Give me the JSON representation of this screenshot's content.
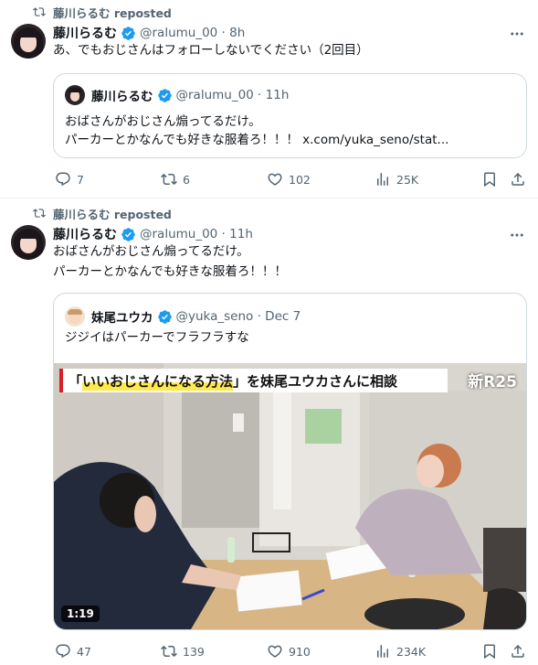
{
  "tweet1": {
    "repost_label": "藤川らるむ reposted",
    "author_name": "藤川らるむ",
    "meta": "@ralumu_00 · 8h",
    "text": "あ、でもおじさんはフォローしないでください（2回目）",
    "quote": {
      "author_name": "藤川らるむ",
      "meta": "@ralumu_00 · 11h",
      "line1": "おばさんがおじさん煽ってるだけ。",
      "line2_text": "パーカーとかなんでも好きな服着ろ！！！ ",
      "line2_link": "x.com/yuka_seno/stat..."
    },
    "actions": {
      "replies": "7",
      "reposts": "6",
      "likes": "102",
      "views": "25K"
    }
  },
  "tweet2": {
    "repost_label": "藤川らるむ reposted",
    "author_name": "藤川らるむ",
    "meta": "@ralumu_00 · 11h",
    "line1": "おばさんがおじさん煽ってるだけ。",
    "line2": "パーカーとかなんでも好きな服着ろ！！！",
    "quote": {
      "author_name": "妹尾ユウカ",
      "meta": "@yuka_seno · Dec 7",
      "text": "ジジイはパーカーでフラフラすな",
      "video": {
        "title_a": "「",
        "title_b": "いいおじさんになる方法",
        "title_c": "」を妹尾ユウカさんに相談",
        "logo": "新R25",
        "duration": "1:19"
      }
    },
    "actions": {
      "replies": "47",
      "reposts": "139",
      "likes": "910",
      "views": "234K"
    }
  },
  "colors": {
    "text": "#0f1419",
    "muted": "#536471",
    "verified": "#1d9bf0",
    "border": "#cfd9de"
  }
}
